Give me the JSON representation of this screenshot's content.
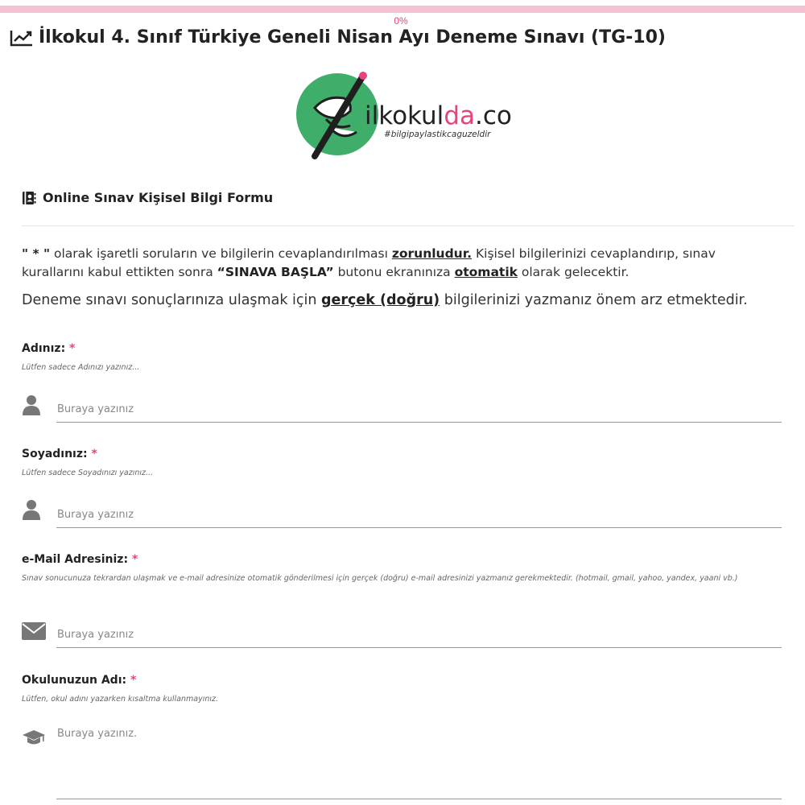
{
  "progress": {
    "percent": 0,
    "label": "0%"
  },
  "header": {
    "title": "İlkokul 4. Sınıf Türkiye Geneli Nisan Ayı Deneme Sınavı (TG-10)"
  },
  "logo": {
    "brand_prefix": "ilkokul",
    "brand_accent": "da",
    "brand_suffix": ".com",
    "tagline": "#bilgipaylastikcaguzeldir",
    "circle_color": "#3fae6b",
    "accent_color": "#e8437f"
  },
  "form": {
    "title": "Online Sınav Kişisel Bilgi Formu",
    "intro": {
      "mark": "\" * \"",
      "t1": " olarak işaretli soruların ve bilgilerin cevaplandırılması ",
      "u1": "zorunludur.",
      "t2": " Kişisel bilgilerinizi cevaplandırıp, sınav kurallarını kabul ettikten sonra ",
      "b2": "“SINAVA BAŞLA”",
      "t3": " butonu ekranınıza ",
      "u3": "otomatik",
      "t4": " olarak gelecektir."
    },
    "intro2": {
      "t1": "Deneme sınavı sonuçlarınıza ulaşmak için ",
      "u1": "gerçek (doğru)",
      "t2": " bilgilerinizi yazmanız önem arz etmektedir."
    },
    "required_mark": "*",
    "fields": [
      {
        "label": "Adınız:",
        "hint": "Lütfen sadece Adınızı yazınız...",
        "placeholder": "Buraya yazınız",
        "icon": "user-icon"
      },
      {
        "label": "Soyadınız:",
        "hint": "Lütfen sadece Soyadınızı yazınız...",
        "placeholder": "Buraya yazınız",
        "icon": "user-icon"
      },
      {
        "label": "e-Mail Adresiniz:",
        "hint": "Sınav sonucunuza tekrardan ulaşmak ve e-mail adresinize otomatik gönderilmesi için gerçek (doğru) e-mail adresinizi yazmanız gerekmektedir. (hotmail, gmail, yahoo, yandex, yaani vb.)",
        "placeholder": "Buraya yazınız",
        "icon": "envelope-icon"
      },
      {
        "label": "Okulunuzun Adı:",
        "hint": "Lütfen, okul adını yazarken kısaltma kullanmayınız.",
        "placeholder": "Buraya yazınız.",
        "icon": "graduation-cap-icon"
      }
    ]
  },
  "colors": {
    "accent": "#e8437f",
    "progress_track": "#f4c0d3",
    "text": "#333333"
  }
}
